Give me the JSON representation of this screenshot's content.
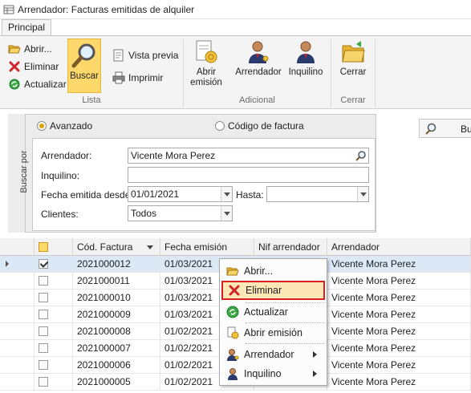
{
  "window": {
    "title": "Arrendador: Facturas emitidas de alquiler"
  },
  "ribbon": {
    "tab": "Principal",
    "lista": {
      "label": "Lista",
      "abrir": "Abrir...",
      "eliminar": "Eliminar",
      "actualizar": "Actualizar",
      "buscar": "Buscar",
      "vista_previa": "Vista previa",
      "imprimir": "Imprimir"
    },
    "adicional": {
      "label": "Adicional",
      "abrir_emision_line1": "Abrir",
      "abrir_emision_line2": "emisión",
      "arrendador": "Arrendador",
      "inquilino": "Inquilino"
    },
    "cerrar": {
      "label": "Cerrar",
      "button": "Cerrar"
    }
  },
  "search": {
    "side_label": "Buscar por",
    "mode_advanced": "Avanzado",
    "mode_code": "Código de factura",
    "selected_mode": "Avanzado",
    "arrendador_label": "Arrendador:",
    "arrendador_value": "Vicente Mora Perez",
    "inquilino_label": "Inquilino:",
    "inquilino_value": "",
    "fecha_desde_label": "Fecha emitida desde:",
    "fecha_desde_value": "01/01/2021",
    "hasta_label": "Hasta:",
    "hasta_value": "",
    "clientes_label": "Clientes:",
    "clientes_value": "Todos",
    "search_button": "Bu"
  },
  "grid": {
    "columns": [
      "Cód. Factura",
      "Fecha emisión",
      "Nif arrendador",
      "Arrendador"
    ],
    "rows": [
      {
        "codigo": "2021000012",
        "fecha": "01/03/2021",
        "nif": "",
        "arrendador": "Vicente Mora Perez",
        "checked": true,
        "selected": true
      },
      {
        "codigo": "2021000011",
        "fecha": "01/03/2021",
        "nif": "",
        "arrendador": "Vicente Mora Perez",
        "checked": false,
        "selected": false
      },
      {
        "codigo": "2021000010",
        "fecha": "01/03/2021",
        "nif": "",
        "arrendador": "Vicente Mora Perez",
        "checked": false,
        "selected": false
      },
      {
        "codigo": "2021000009",
        "fecha": "01/03/2021",
        "nif": "",
        "arrendador": "Vicente Mora Perez",
        "checked": false,
        "selected": false
      },
      {
        "codigo": "2021000008",
        "fecha": "01/02/2021",
        "nif": "",
        "arrendador": "Vicente Mora Perez",
        "checked": false,
        "selected": false
      },
      {
        "codigo": "2021000007",
        "fecha": "01/02/2021",
        "nif": "",
        "arrendador": "Vicente Mora Perez",
        "checked": false,
        "selected": false
      },
      {
        "codigo": "2021000006",
        "fecha": "01/02/2021",
        "nif": "",
        "arrendador": "Vicente Mora Perez",
        "checked": false,
        "selected": false
      },
      {
        "codigo": "2021000005",
        "fecha": "01/02/2021",
        "nif": "",
        "arrendador": "Vicente Mora Perez",
        "checked": false,
        "selected": false
      }
    ]
  },
  "context_menu": {
    "abrir": "Abrir...",
    "eliminar": "Eliminar",
    "actualizar": "Actualizar",
    "abrir_emision": "Abrir emisión",
    "arrendador": "Arrendador",
    "inquilino": "Inquilino",
    "highlighted": "Eliminar"
  },
  "colors": {
    "accent": "#ffd86b",
    "highlight_border": "#d91f1f",
    "selected_row": "#dbe8f6"
  }
}
